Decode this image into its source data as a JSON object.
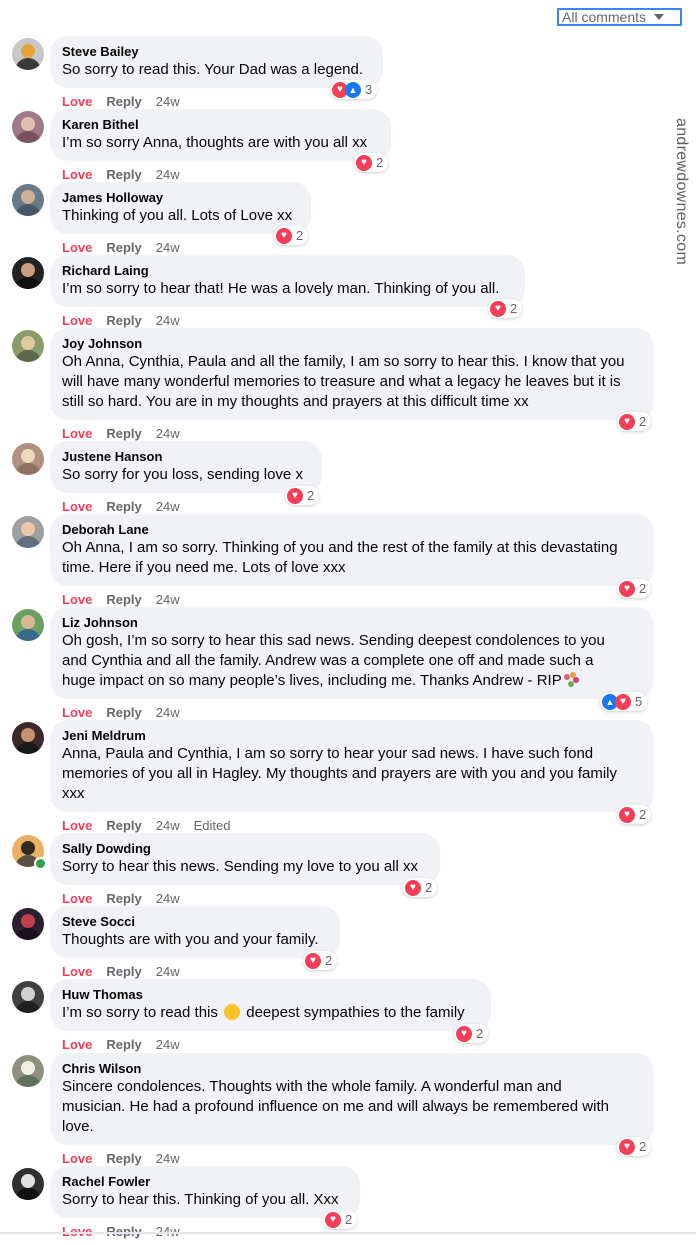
{
  "filter": {
    "label": "All comments"
  },
  "watermark": "andrewdownes.com",
  "actions": {
    "love": "Love",
    "reply": "Reply"
  },
  "comments": [
    {
      "name": "Steve Bailey",
      "text": [
        "So sorry to read this. Your Dad was a legend."
      ],
      "time": "24w",
      "reactions": {
        "count": "3",
        "types": [
          "love",
          "like"
        ]
      },
      "edited": ""
    },
    {
      "name": "Karen Bithel",
      "text": [
        "I’m so sorry Anna, thoughts are with you all xx"
      ],
      "time": "24w",
      "reactions": {
        "count": "2",
        "types": [
          "love"
        ]
      },
      "edited": ""
    },
    {
      "name": "James Holloway",
      "text": [
        "Thinking of you all. Lots of Love xx"
      ],
      "time": "24w",
      "reactions": {
        "count": "2",
        "types": [
          "love"
        ]
      },
      "edited": ""
    },
    {
      "name": "Richard Laing",
      "text": [
        "I’m so sorry to hear that! He was a lovely man. Thinking of you all."
      ],
      "time": "24w",
      "reactions": {
        "count": "2",
        "types": [
          "love"
        ]
      },
      "edited": ""
    },
    {
      "name": "Joy Johnson",
      "text": [
        "Oh Anna, Cynthia, Paula and all the family, I am so sorry to hear this. I know that you",
        "will have many wonderful memories to treasure and what a legacy he leaves but it is",
        "still so hard. You are in my thoughts and prayers at this difficult time xx"
      ],
      "time": "24w",
      "reactions": {
        "count": "2",
        "types": [
          "love"
        ]
      },
      "edited": ""
    },
    {
      "name": "Justene Hanson",
      "text": [
        "So sorry for you loss, sending love x"
      ],
      "time": "24w",
      "reactions": {
        "count": "2",
        "types": [
          "love"
        ]
      },
      "edited": ""
    },
    {
      "name": "Deborah Lane",
      "text": [
        "Oh Anna, I am so sorry. Thinking of you and the rest of the family at this devastating",
        "time. Here if you need me. Lots of love xxx"
      ],
      "time": "24w",
      "reactions": {
        "count": "2",
        "types": [
          "love"
        ]
      },
      "edited": ""
    },
    {
      "name": "Liz Johnson",
      "text": [
        "Oh gosh, I’m so sorry to hear this sad news. Sending deepest condolences to you",
        "and Cynthia and all the family. Andrew was a complete one off and made such a",
        "huge impact on so many people’s lives, including me. Thanks Andrew - RIP"
      ],
      "time": "24w",
      "reactions": {
        "count": "5",
        "types": [
          "like",
          "love"
        ]
      },
      "edited": "",
      "trailing_emoji": "bouquet-emoji"
    },
    {
      "name": "Jeni Meldrum",
      "text": [
        "Anna, Paula and Cynthia, I am so sorry to hear your sad news. I have such fond",
        "memories of you all in Hagley. My thoughts and prayers are with you and you family",
        "xxx"
      ],
      "time": "24w",
      "reactions": {
        "count": "2",
        "types": [
          "love"
        ]
      },
      "edited": "Edited"
    },
    {
      "name": "Sally Dowding",
      "text": [
        "Sorry to hear this news. Sending my love to you all xx"
      ],
      "time": "24w",
      "reactions": {
        "count": "2",
        "types": [
          "love"
        ]
      },
      "edited": "",
      "online": true
    },
    {
      "name": "Steve Socci",
      "text": [
        "Thoughts are with you and your family."
      ],
      "time": "24w",
      "reactions": {
        "count": "2",
        "types": [
          "love"
        ]
      },
      "edited": ""
    },
    {
      "name": "Huw Thomas",
      "text_before": "I’m so sorry to read this",
      "text_after": "deepest sympathies to the family",
      "time": "24w",
      "reactions": {
        "count": "2",
        "types": [
          "love"
        ]
      },
      "edited": "",
      "inline_emoji": "sad-face-emoji"
    },
    {
      "name": "Chris Wilson",
      "text": [
        "Sincere condolences. Thoughts with the whole family. A wonderful man and",
        "musician. He had a profound influence on me and will always be remembered with",
        "love."
      ],
      "time": "24w",
      "reactions": {
        "count": "2",
        "types": [
          "love"
        ]
      },
      "edited": ""
    },
    {
      "name": "Rachel Fowler",
      "text": [
        "Sorry to hear this. Thinking of you all. Xxx"
      ],
      "time": "24w",
      "reactions": {
        "count": "2",
        "types": [
          "love"
        ]
      },
      "edited": ""
    }
  ]
}
